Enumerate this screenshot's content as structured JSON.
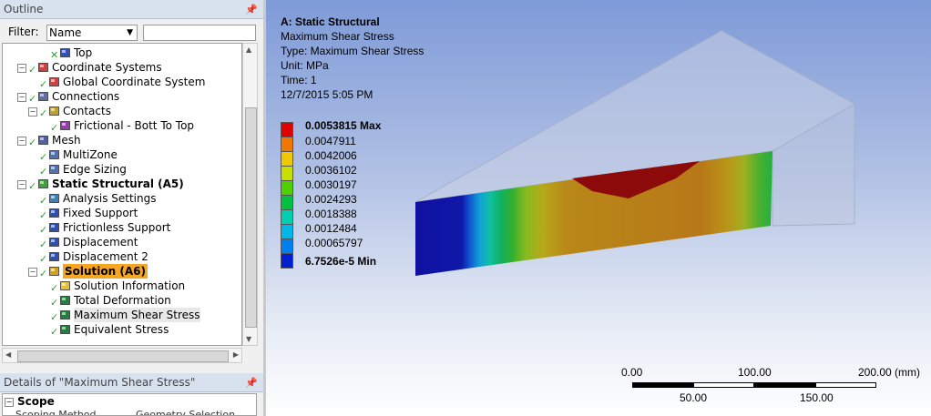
{
  "outline": {
    "header": "Outline",
    "pin": "ᵖ",
    "filter_label": "Filter:",
    "filter_value": "Name",
    "tree": [
      {
        "label": "Top",
        "depth": 4,
        "icon": "view-cube-icon",
        "status": "partial"
      },
      {
        "label": "Coordinate Systems",
        "depth": 2,
        "icon": "coordinate-axes-icon",
        "status": "ok",
        "expander": "−"
      },
      {
        "label": "Global Coordinate System",
        "depth": 3,
        "icon": "coordinate-axes-icon",
        "status": "ok"
      },
      {
        "label": "Connections",
        "depth": 2,
        "icon": "connections-icon",
        "status": "ok",
        "expander": "−"
      },
      {
        "label": "Contacts",
        "depth": 3,
        "icon": "contacts-folder-icon",
        "status": "ok",
        "expander": "−"
      },
      {
        "label": "Frictional - Bott To Top",
        "depth": 4,
        "icon": "contact-pair-icon",
        "status": "ok"
      },
      {
        "label": "Mesh",
        "depth": 2,
        "icon": "mesh-icon",
        "status": "ok",
        "expander": "−"
      },
      {
        "label": "MultiZone",
        "depth": 3,
        "icon": "mesh-method-icon",
        "status": "ok"
      },
      {
        "label": "Edge Sizing",
        "depth": 3,
        "icon": "mesh-sizing-icon",
        "status": "ok"
      },
      {
        "label": "Static Structural (A5)",
        "depth": 2,
        "icon": "static-structural-icon",
        "status": "ok",
        "expander": "−",
        "bold": true
      },
      {
        "label": "Analysis Settings",
        "depth": 3,
        "icon": "analysis-settings-icon",
        "status": "ok"
      },
      {
        "label": "Fixed Support",
        "depth": 3,
        "icon": "fixed-support-icon",
        "status": "ok"
      },
      {
        "label": "Frictionless Support",
        "depth": 3,
        "icon": "frictionless-support-icon",
        "status": "ok"
      },
      {
        "label": "Displacement",
        "depth": 3,
        "icon": "displacement-icon",
        "status": "ok"
      },
      {
        "label": "Displacement 2",
        "depth": 3,
        "icon": "displacement-icon",
        "status": "ok"
      },
      {
        "label": "Solution (A6)",
        "depth": 3,
        "icon": "solution-icon",
        "status": "ok",
        "expander": "−",
        "selected": true
      },
      {
        "label": "Solution Information",
        "depth": 4,
        "icon": "solution-information-icon",
        "status": "ok"
      },
      {
        "label": "Total Deformation",
        "depth": 4,
        "icon": "result-cube-icon",
        "status": "ok"
      },
      {
        "label": "Maximum Shear Stress",
        "depth": 4,
        "icon": "result-cube-icon",
        "status": "ok",
        "highlight": true
      },
      {
        "label": "Equivalent Stress",
        "depth": 4,
        "icon": "result-cube-icon",
        "status": "ok"
      }
    ]
  },
  "details": {
    "header": "Details of \"Maximum Shear Stress\"",
    "pin": "ᵖ",
    "scope_label": "Scope",
    "col1": "Scoping Method",
    "col2": "Geometry Selection"
  },
  "viewport": {
    "title": "A: Static Structural",
    "result": "Maximum Shear Stress",
    "type_line": "Type: Maximum Shear Stress",
    "unit_line": "Unit: MPa",
    "time_line": "Time: 1",
    "date_line": "12/7/2015 5:05 PM"
  },
  "legend": [
    {
      "label": "0.0053815 Max",
      "color": "#e00000",
      "bold": true
    },
    {
      "label": "0.0047911",
      "color": "#f07800"
    },
    {
      "label": "0.0042006",
      "color": "#f0c800"
    },
    {
      "label": "0.0036102",
      "color": "#c8e000"
    },
    {
      "label": "0.0030197",
      "color": "#50d000"
    },
    {
      "label": "0.0024293",
      "color": "#00c040"
    },
    {
      "label": "0.0018388",
      "color": "#00d0b0"
    },
    {
      "label": "0.0012484",
      "color": "#00b8e8"
    },
    {
      "label": "0.00065797",
      "color": "#0080f0"
    },
    {
      "label": "6.7526e-5 Min",
      "color": "#0020d0",
      "bold": true
    }
  ],
  "scale": {
    "top_labels": [
      "0.00",
      "100.00",
      "200.00 (mm)"
    ],
    "bottom_labels": [
      "50.00",
      "150.00"
    ]
  }
}
